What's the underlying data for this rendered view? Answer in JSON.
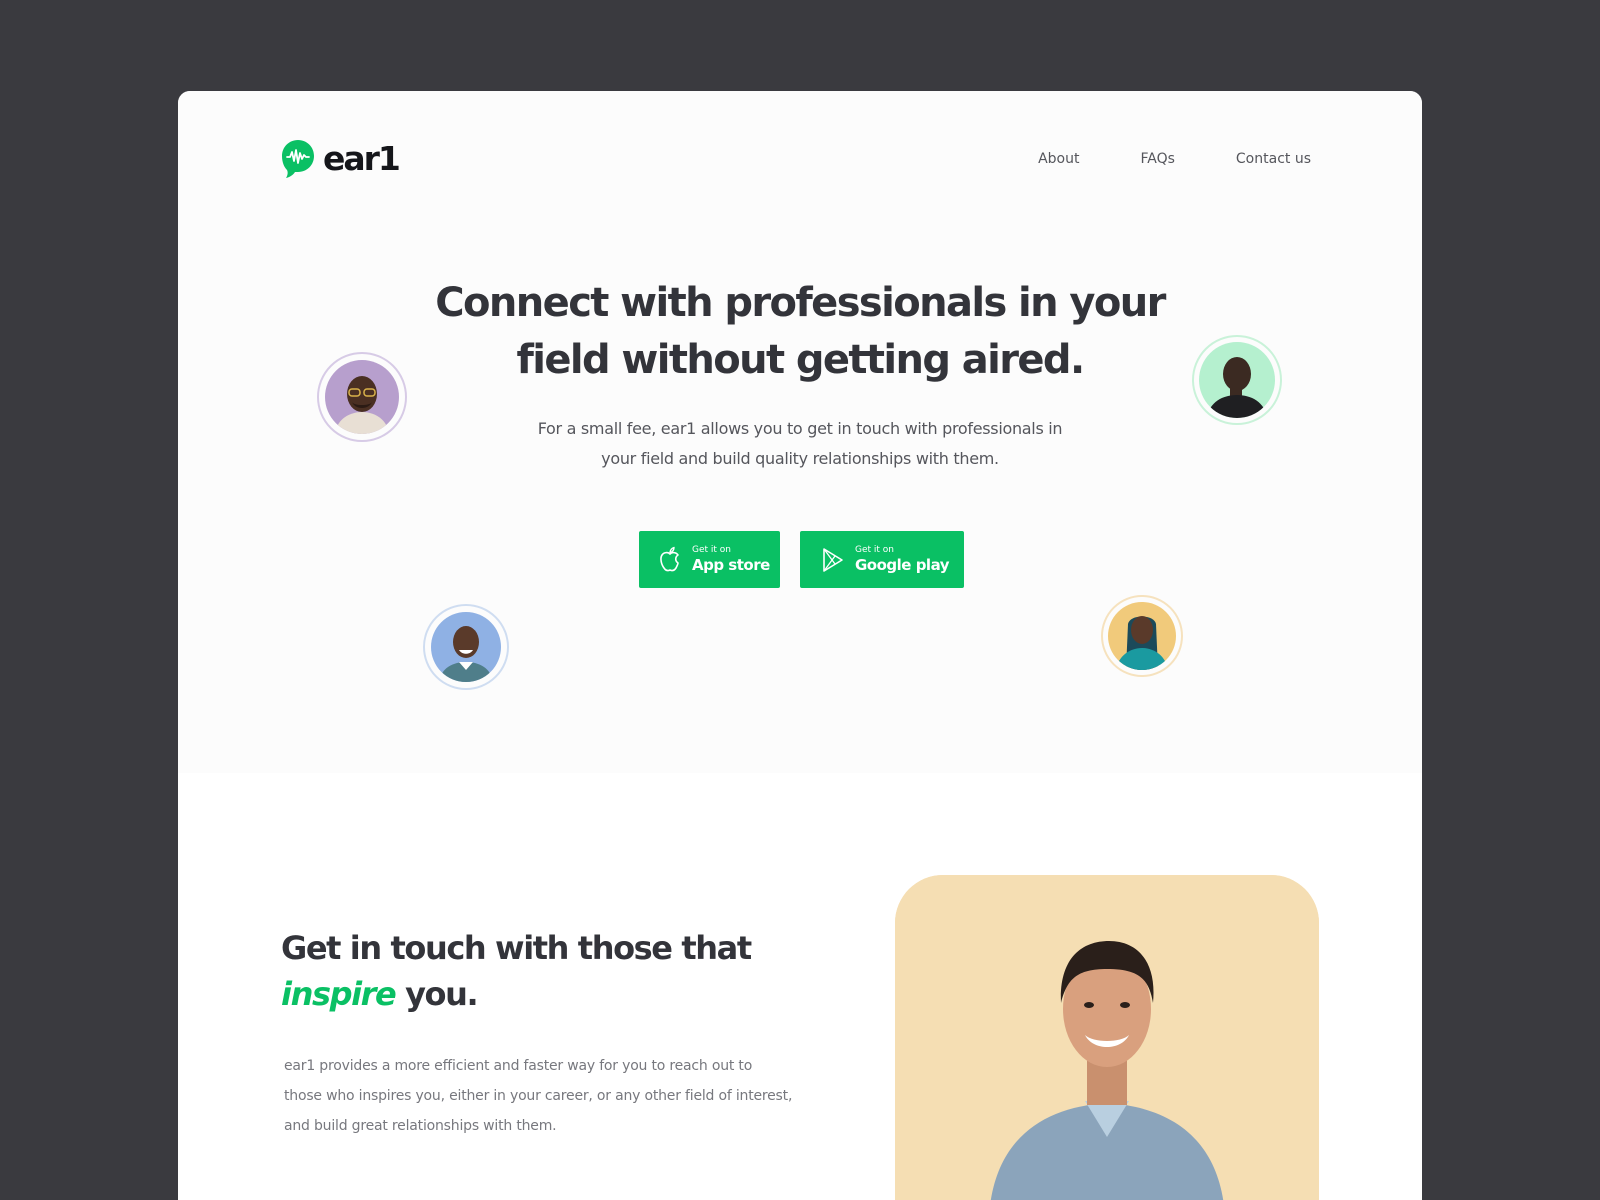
{
  "brand": {
    "name": "ear1",
    "accent": "#0ac064"
  },
  "nav": {
    "links": [
      "About",
      "FAQs",
      "Contact us"
    ]
  },
  "hero": {
    "headline": [
      "Connect with professionals in your",
      "field without getting aired."
    ],
    "subhead": [
      "For a small fee, ear1 allows you to get in touch with professionals in",
      "your field and build quality relationships with them."
    ],
    "app_store": {
      "small": "Get it on",
      "big": "App store",
      "icon": "apple-icon"
    },
    "google_play": {
      "small": "Get it on",
      "big": "Google play",
      "icon": "play-icon"
    },
    "avatar_colors": [
      "#b79fcd",
      "#b5f0cf",
      "#8fb1e4",
      "#f1ca7b"
    ]
  },
  "section2": {
    "title_line1": "Get in touch with those that",
    "title_accent": "inspire",
    "title_rest": " you.",
    "body": [
      "ear1 provides a more efficient and faster way for you to reach out to",
      "those who inspires you, either in your career, or any other field of interest,",
      "and build great relationships with them."
    ],
    "photo_bg": "#f5deb3"
  }
}
